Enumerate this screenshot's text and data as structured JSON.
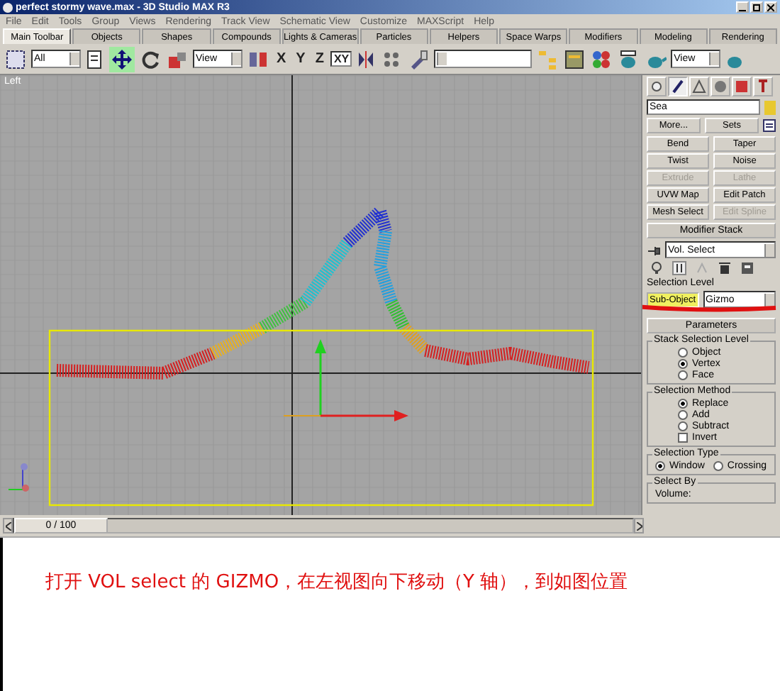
{
  "window": {
    "title": "perfect stormy wave.max - 3D Studio MAX R3"
  },
  "menu": [
    "File",
    "Edit",
    "Tools",
    "Group",
    "Views",
    "Rendering",
    "Track View",
    "Schematic View",
    "Customize",
    "MAXScript",
    "Help"
  ],
  "tabs": [
    {
      "label": "Main Toolbar",
      "selected": true
    },
    {
      "label": "Objects",
      "selected": false
    },
    {
      "label": "Shapes",
      "selected": false
    },
    {
      "label": "Compounds",
      "selected": false
    },
    {
      "label": "Lights & Cameras",
      "selected": false
    },
    {
      "label": "Particles",
      "selected": false
    },
    {
      "label": "Helpers",
      "selected": false
    },
    {
      "label": "Space Warps",
      "selected": false
    },
    {
      "label": "Modifiers",
      "selected": false
    },
    {
      "label": "Modeling",
      "selected": false
    },
    {
      "label": "Rendering",
      "selected": false
    }
  ],
  "toolbar": {
    "filter": "All",
    "coord": "View",
    "axes": [
      {
        "label": "X",
        "selected": false
      },
      {
        "label": "Y",
        "selected": false
      },
      {
        "label": "Z",
        "selected": false
      },
      {
        "label": "XY",
        "selected": true
      }
    ],
    "render_view": "View"
  },
  "viewport": {
    "label": "Left"
  },
  "command_panel": {
    "name": "Sea",
    "more": "More...",
    "sets": "Sets",
    "modifiers": [
      {
        "label": "Bend",
        "disabled": false
      },
      {
        "label": "Taper",
        "disabled": false
      },
      {
        "label": "Twist",
        "disabled": false
      },
      {
        "label": "Noise",
        "disabled": false
      },
      {
        "label": "Extrude",
        "disabled": true
      },
      {
        "label": "Lathe",
        "disabled": true
      },
      {
        "label": "UVW Map",
        "disabled": false
      },
      {
        "label": "Edit Patch",
        "disabled": false
      },
      {
        "label": "Mesh Select",
        "disabled": false
      },
      {
        "label": "Edit Spline",
        "disabled": true
      }
    ],
    "stack_title": "Modifier Stack",
    "stack_value": "Vol. Select",
    "selection_level_label": "Selection Level",
    "sub_object": {
      "label": "Sub-Object",
      "on": true
    },
    "level_value": "Gizmo",
    "parameters_title": "Parameters",
    "groups": [
      {
        "title": "Stack Selection Level",
        "items": [
          {
            "kind": "radio",
            "label": "Object",
            "selected": false
          },
          {
            "kind": "radio",
            "label": "Vertex",
            "selected": true
          },
          {
            "kind": "radio",
            "label": "Face",
            "selected": false
          }
        ]
      },
      {
        "title": "Selection Method",
        "items": [
          {
            "kind": "radio",
            "label": "Replace",
            "selected": true
          },
          {
            "kind": "radio",
            "label": "Add",
            "selected": false
          },
          {
            "kind": "radio",
            "label": "Subtract",
            "selected": false
          },
          {
            "kind": "checkbox",
            "label": "Invert",
            "selected": false
          }
        ]
      },
      {
        "title": "Selection Type",
        "inline": true,
        "items": [
          {
            "kind": "radio",
            "label": "Window",
            "selected": true
          },
          {
            "kind": "radio",
            "label": "Crossing",
            "selected": false
          }
        ]
      },
      {
        "title": "Select By",
        "items": [
          {
            "kind": "text",
            "label": "Volume:"
          }
        ]
      }
    ]
  },
  "timeline": {
    "frame": "0 / 100",
    "level": 0
  },
  "caption": "打开 VOL select 的 GIZMO，在左视图向下移动（Y 轴），到如图位置"
}
